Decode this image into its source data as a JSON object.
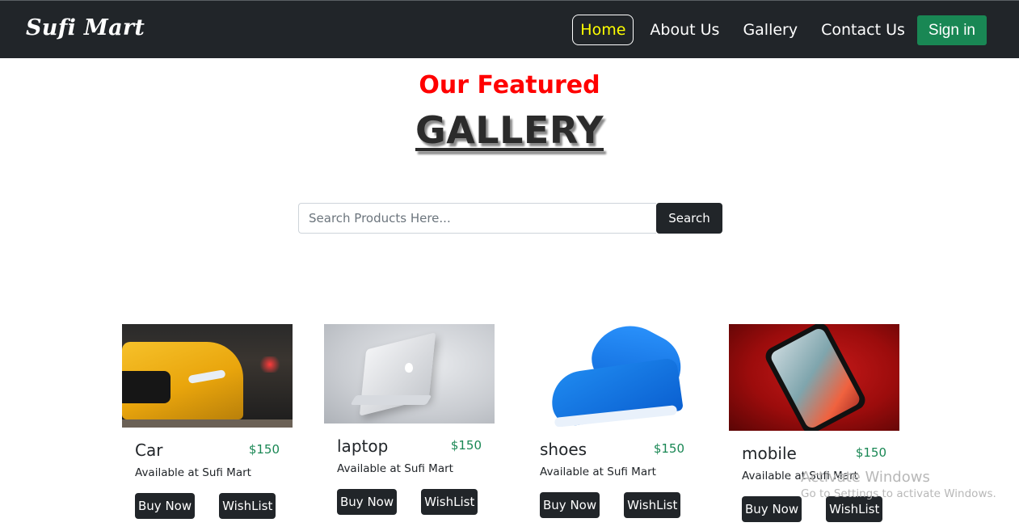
{
  "navbar": {
    "brand": "Sufi Mart",
    "links": [
      {
        "label": "Home",
        "active": true
      },
      {
        "label": "About Us",
        "active": false
      },
      {
        "label": "Gallery",
        "active": false
      },
      {
        "label": "Contact Us",
        "active": false
      }
    ],
    "signin_label": "Sign in"
  },
  "hero": {
    "featured": "Our Featured",
    "title": "GALLERY"
  },
  "search": {
    "placeholder": "Search Products Here...",
    "button_label": "Search"
  },
  "products": [
    {
      "title": "Car",
      "price": "$150",
      "text": "Available at Sufi Mart",
      "buy_label": "Buy Now",
      "wish_label": "WishList"
    },
    {
      "title": "laptop",
      "price": "$150",
      "text": "Available at Sufi Mart",
      "buy_label": "Buy Now",
      "wish_label": "WishList"
    },
    {
      "title": "shoes",
      "price": "$150",
      "text": "Available at Sufi Mart",
      "buy_label": "Buy Now",
      "wish_label": "WishList"
    },
    {
      "title": "mobile",
      "price": "$150",
      "text": "Available at Sufi Mart",
      "buy_label": "Buy Now",
      "wish_label": "WishList"
    }
  ],
  "watermark": {
    "title": "Activate Windows",
    "subtitle": "Go to Settings to activate Windows."
  },
  "colors": {
    "navbar_bg": "#212529",
    "active_link": "#ffff00",
    "featured": "#ff0000",
    "signin_bg": "#198754",
    "price": "#198754"
  }
}
